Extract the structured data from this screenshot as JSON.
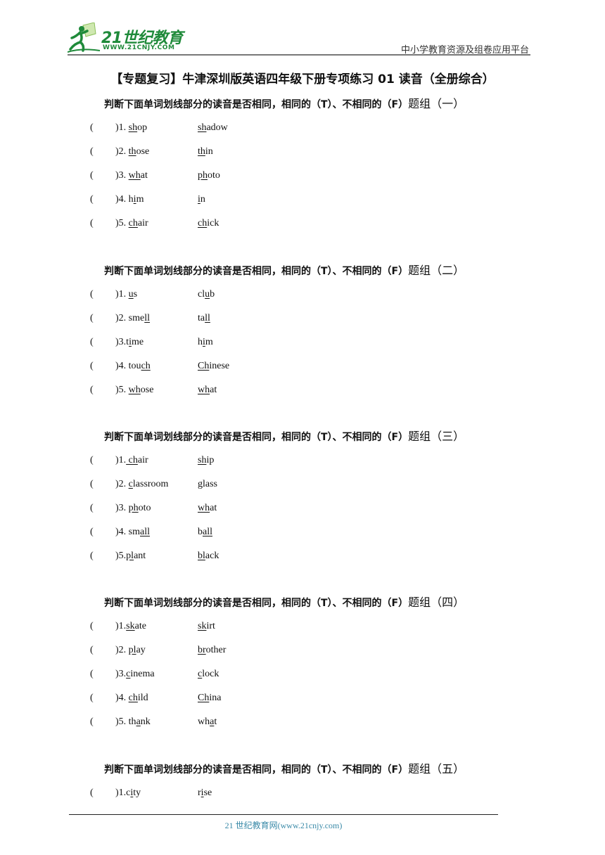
{
  "header": {
    "logo_text": "21世纪教育",
    "logo_url": "WWW.21CNJY.COM",
    "platform": "中小学教育资源及组卷应用平台",
    "brand_color": "#1f8a3a"
  },
  "title": "【专题复习】牛津深圳版英语四年级下册专项练习 01  读音（全册综合）",
  "groups": [
    {
      "heading": "判断下面单词划线部分的读音是否相同，相同的（T）、不相同的（F）",
      "heading_tail": "题组（一）",
      "items": [
        {
          "num": ")1. ",
          "w1": [
            [
              "",
              "sh",
              "op"
            ]
          ],
          "w2": [
            [
              "",
              "sh",
              "adow"
            ]
          ]
        },
        {
          "num": ")2. ",
          "w1": [
            [
              "",
              "th",
              "ose"
            ]
          ],
          "w2": [
            [
              "",
              "th",
              "in"
            ]
          ]
        },
        {
          "num": ")3. ",
          "w1": [
            [
              "",
              "wh",
              "at"
            ]
          ],
          "w2": [
            [
              "",
              "ph",
              "oto"
            ]
          ]
        },
        {
          "num": ")4. ",
          "w1": [
            [
              "h",
              "i",
              "m"
            ]
          ],
          "w2": [
            [
              "",
              "i",
              "n"
            ]
          ]
        },
        {
          "num": ")5. ",
          "w1": [
            [
              "",
              "ch",
              "air"
            ]
          ],
          "w2": [
            [
              "",
              "ch",
              "ick"
            ]
          ]
        }
      ]
    },
    {
      "heading": "判断下面单词划线部分的读音是否相同，相同的（T）、不相同的（F）",
      "heading_tail": "题组（二）",
      "items": [
        {
          "num": ")1. ",
          "w1": [
            [
              "",
              "u",
              "s"
            ]
          ],
          "w2": [
            [
              "cl",
              "u",
              "b"
            ]
          ]
        },
        {
          "num": ")2. ",
          "w1": [
            [
              "sme",
              "ll",
              ""
            ]
          ],
          "w2": [
            [
              "ta",
              "ll",
              ""
            ]
          ]
        },
        {
          "num": ")3.",
          "w1": [
            [
              "t",
              "i",
              "me"
            ]
          ],
          "w2": [
            [
              "h",
              "i",
              "m"
            ]
          ]
        },
        {
          "num": ")4. ",
          "w1": [
            [
              "tou",
              "ch",
              ""
            ]
          ],
          "w2": [
            [
              "",
              "Ch",
              "inese"
            ]
          ]
        },
        {
          "num": ")5. ",
          "w1": [
            [
              "",
              "wh",
              "ose"
            ]
          ],
          "w2": [
            [
              "",
              "wh",
              "at"
            ]
          ]
        }
      ]
    },
    {
      "heading": "判断下面单词划线部分的读音是否相同，相同的（T）、不相同的（F）",
      "heading_tail": "题组（三）",
      "items": [
        {
          "num": ")1.",
          "w1": [
            [
              "",
              " ch",
              "air"
            ]
          ],
          "w2": [
            [
              "",
              "sh",
              "ip"
            ]
          ]
        },
        {
          "num": ")2. ",
          "w1": [
            [
              "",
              "c",
              "lassroom"
            ]
          ],
          "w2": [
            [
              "",
              "g",
              "lass"
            ]
          ]
        },
        {
          "num": ")3. ",
          "w1": [
            [
              "",
              "ph",
              "oto"
            ]
          ],
          "w2": [
            [
              "",
              "wh",
              "at"
            ]
          ]
        },
        {
          "num": ")4. ",
          "w1": [
            [
              "sm",
              "all",
              ""
            ]
          ],
          "w2": [
            [
              "b",
              "all",
              ""
            ]
          ]
        },
        {
          "num": ")5.",
          "w1": [
            [
              "",
              "pl",
              "ant"
            ]
          ],
          "w2": [
            [
              "",
              "bl",
              "ack"
            ]
          ]
        }
      ]
    },
    {
      "heading": "判断下面单词划线部分的读音是否相同，相同的（T）、不相同的（F）",
      "heading_tail": "题组（四）",
      "items": [
        {
          "num": ")1.",
          "w1": [
            [
              "",
              "sk",
              "ate"
            ]
          ],
          "w2": [
            [
              "",
              "sk",
              "irt"
            ]
          ]
        },
        {
          "num": ")2. ",
          "w1": [
            [
              "",
              "pl",
              "ay"
            ]
          ],
          "w2": [
            [
              "",
              "br",
              "other"
            ]
          ]
        },
        {
          "num": ")3.",
          "w1": [
            [
              "",
              "c",
              "inema"
            ]
          ],
          "w2": [
            [
              "",
              "c",
              "lock"
            ]
          ]
        },
        {
          "num": ")4. ",
          "w1": [
            [
              "",
              "ch",
              "ild"
            ]
          ],
          "w2": [
            [
              "",
              "Ch",
              "ina"
            ]
          ]
        },
        {
          "num": ")5. ",
          "w1": [
            [
              "th",
              "a",
              "nk"
            ]
          ],
          "w2": [
            [
              "wh",
              "a",
              "t"
            ]
          ]
        }
      ]
    },
    {
      "heading": "判断下面单词划线部分的读音是否相同，相同的（T）、不相同的（F）",
      "heading_tail": "题组（五）",
      "items": [
        {
          "num": ")1.",
          "w1": [
            [
              "c",
              "i",
              "ty"
            ]
          ],
          "w2": [
            [
              "r",
              "i",
              "se"
            ]
          ]
        }
      ]
    }
  ],
  "paren": "(",
  "footer": "21 世纪教育网(www.21cnjy.com)"
}
